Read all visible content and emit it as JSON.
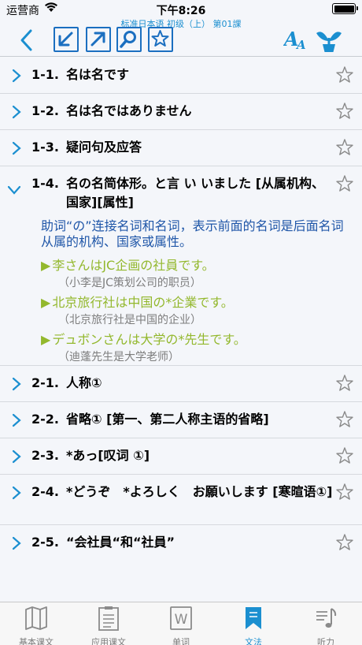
{
  "status": {
    "carrier": "运营商",
    "time": "下午8:26"
  },
  "nav": {
    "subtitle": "标准日本语 初级（上） 第01課"
  },
  "rows": [
    {
      "num": "1-1.",
      "title": "名は名です"
    },
    {
      "num": "1-2.",
      "title": "名は名ではありません"
    },
    {
      "num": "1-3.",
      "title": "疑问句及应答"
    },
    {
      "num": "1-4.",
      "title": "名の名简体形。と言 い いました [从属机构、国家][属性]"
    },
    {
      "num": "2-1.",
      "title": "人称①"
    },
    {
      "num": "2-2.",
      "title": "省略① [第一、第二人称主语的省略]"
    },
    {
      "num": "2-3.",
      "title": "*あっ[叹词 ①]"
    },
    {
      "num": "2-4.",
      "title": "*どうぞ　*よろしく　お願いします [寒暄语①]"
    },
    {
      "num": "2-5.",
      "title": "“会社員“和“社員”"
    }
  ],
  "expanded": {
    "desc": "助词“の”连接名词和名词，表示前面的名词是后面名词从属的机构、国家或属性。",
    "examples": [
      {
        "jp": "李さんはJC企画の社員です。",
        "cn": "（小李是JC策划公司的职员）"
      },
      {
        "jp": "北京旅行社は中国の*企業です。",
        "cn": "（北京旅行社是中国的企业）"
      },
      {
        "jp": "デュボンさんは大学の*先生です。",
        "cn": "（迪蓬先生是大学老师）"
      }
    ]
  },
  "tabs": [
    {
      "label": "基本课文",
      "icon": "map-icon"
    },
    {
      "label": "应用课文",
      "icon": "document-icon"
    },
    {
      "label": "单词",
      "icon": "word-icon"
    },
    {
      "label": "文法",
      "icon": "bookmark-icon"
    },
    {
      "label": "听力",
      "icon": "music-icon"
    }
  ],
  "colors": {
    "accent": "#1b8fd0",
    "example": "#93b82d",
    "desc": "#1f56a8"
  }
}
